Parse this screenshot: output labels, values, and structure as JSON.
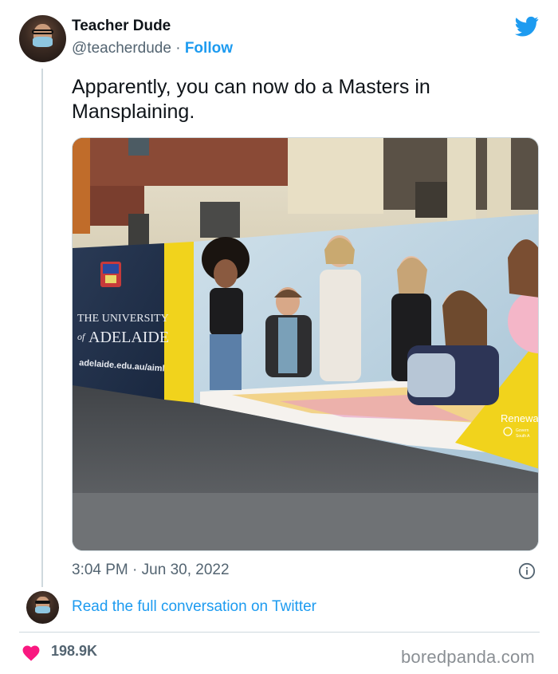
{
  "tweet": {
    "author_name": "Teacher Dude",
    "handle": "@teacherdude",
    "separator": "·",
    "follow_label": "Follow",
    "text": "Apparently, you can now do a Masters in Mansplaining.",
    "time": "3:04 PM",
    "date_separator": "·",
    "date": "Jun 30, 2022",
    "read_full_label": "Read the full conversation on Twitter",
    "likes": "198.9K",
    "icons": [
      "twitter-bird-icon",
      "info-icon",
      "heart-icon"
    ],
    "colors": {
      "accent": "#1d9bf0",
      "heart": "#f91880",
      "text": "#0f1419",
      "muted": "#536471"
    }
  },
  "photo": {
    "banner_university_line1": "THE UNIVERSITY",
    "banner_university_line2": "ADELAIDE",
    "banner_prefix": "of",
    "banner_url": "adelaide.edu.au/aiml",
    "banner_corner_text": "Renewa",
    "banner_corner_small1": "Govern",
    "banner_corner_small2": "South A"
  },
  "watermark": "boredpanda.com"
}
